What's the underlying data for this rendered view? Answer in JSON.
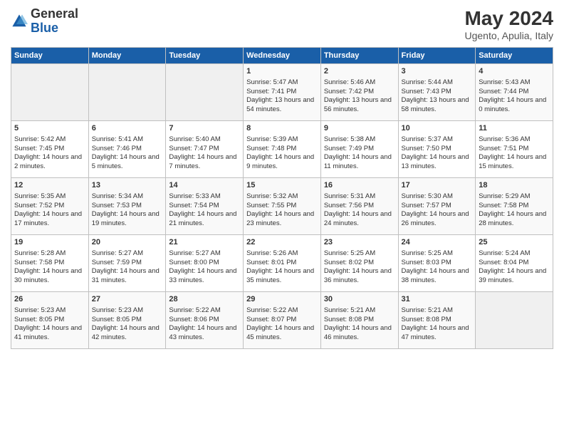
{
  "header": {
    "logo_general": "General",
    "logo_blue": "Blue",
    "month_year": "May 2024",
    "location": "Ugento, Apulia, Italy"
  },
  "days_of_week": [
    "Sunday",
    "Monday",
    "Tuesday",
    "Wednesday",
    "Thursday",
    "Friday",
    "Saturday"
  ],
  "weeks": [
    [
      {
        "day": "",
        "empty": true
      },
      {
        "day": "",
        "empty": true
      },
      {
        "day": "",
        "empty": true
      },
      {
        "day": "1",
        "sunrise": "Sunrise: 5:47 AM",
        "sunset": "Sunset: 7:41 PM",
        "daylight": "Daylight: 13 hours and 54 minutes."
      },
      {
        "day": "2",
        "sunrise": "Sunrise: 5:46 AM",
        "sunset": "Sunset: 7:42 PM",
        "daylight": "Daylight: 13 hours and 56 minutes."
      },
      {
        "day": "3",
        "sunrise": "Sunrise: 5:44 AM",
        "sunset": "Sunset: 7:43 PM",
        "daylight": "Daylight: 13 hours and 58 minutes."
      },
      {
        "day": "4",
        "sunrise": "Sunrise: 5:43 AM",
        "sunset": "Sunset: 7:44 PM",
        "daylight": "Daylight: 14 hours and 0 minutes."
      }
    ],
    [
      {
        "day": "5",
        "sunrise": "Sunrise: 5:42 AM",
        "sunset": "Sunset: 7:45 PM",
        "daylight": "Daylight: 14 hours and 2 minutes."
      },
      {
        "day": "6",
        "sunrise": "Sunrise: 5:41 AM",
        "sunset": "Sunset: 7:46 PM",
        "daylight": "Daylight: 14 hours and 5 minutes."
      },
      {
        "day": "7",
        "sunrise": "Sunrise: 5:40 AM",
        "sunset": "Sunset: 7:47 PM",
        "daylight": "Daylight: 14 hours and 7 minutes."
      },
      {
        "day": "8",
        "sunrise": "Sunrise: 5:39 AM",
        "sunset": "Sunset: 7:48 PM",
        "daylight": "Daylight: 14 hours and 9 minutes."
      },
      {
        "day": "9",
        "sunrise": "Sunrise: 5:38 AM",
        "sunset": "Sunset: 7:49 PM",
        "daylight": "Daylight: 14 hours and 11 minutes."
      },
      {
        "day": "10",
        "sunrise": "Sunrise: 5:37 AM",
        "sunset": "Sunset: 7:50 PM",
        "daylight": "Daylight: 14 hours and 13 minutes."
      },
      {
        "day": "11",
        "sunrise": "Sunrise: 5:36 AM",
        "sunset": "Sunset: 7:51 PM",
        "daylight": "Daylight: 14 hours and 15 minutes."
      }
    ],
    [
      {
        "day": "12",
        "sunrise": "Sunrise: 5:35 AM",
        "sunset": "Sunset: 7:52 PM",
        "daylight": "Daylight: 14 hours and 17 minutes."
      },
      {
        "day": "13",
        "sunrise": "Sunrise: 5:34 AM",
        "sunset": "Sunset: 7:53 PM",
        "daylight": "Daylight: 14 hours and 19 minutes."
      },
      {
        "day": "14",
        "sunrise": "Sunrise: 5:33 AM",
        "sunset": "Sunset: 7:54 PM",
        "daylight": "Daylight: 14 hours and 21 minutes."
      },
      {
        "day": "15",
        "sunrise": "Sunrise: 5:32 AM",
        "sunset": "Sunset: 7:55 PM",
        "daylight": "Daylight: 14 hours and 23 minutes."
      },
      {
        "day": "16",
        "sunrise": "Sunrise: 5:31 AM",
        "sunset": "Sunset: 7:56 PM",
        "daylight": "Daylight: 14 hours and 24 minutes."
      },
      {
        "day": "17",
        "sunrise": "Sunrise: 5:30 AM",
        "sunset": "Sunset: 7:57 PM",
        "daylight": "Daylight: 14 hours and 26 minutes."
      },
      {
        "day": "18",
        "sunrise": "Sunrise: 5:29 AM",
        "sunset": "Sunset: 7:58 PM",
        "daylight": "Daylight: 14 hours and 28 minutes."
      }
    ],
    [
      {
        "day": "19",
        "sunrise": "Sunrise: 5:28 AM",
        "sunset": "Sunset: 7:58 PM",
        "daylight": "Daylight: 14 hours and 30 minutes."
      },
      {
        "day": "20",
        "sunrise": "Sunrise: 5:27 AM",
        "sunset": "Sunset: 7:59 PM",
        "daylight": "Daylight: 14 hours and 31 minutes."
      },
      {
        "day": "21",
        "sunrise": "Sunrise: 5:27 AM",
        "sunset": "Sunset: 8:00 PM",
        "daylight": "Daylight: 14 hours and 33 minutes."
      },
      {
        "day": "22",
        "sunrise": "Sunrise: 5:26 AM",
        "sunset": "Sunset: 8:01 PM",
        "daylight": "Daylight: 14 hours and 35 minutes."
      },
      {
        "day": "23",
        "sunrise": "Sunrise: 5:25 AM",
        "sunset": "Sunset: 8:02 PM",
        "daylight": "Daylight: 14 hours and 36 minutes."
      },
      {
        "day": "24",
        "sunrise": "Sunrise: 5:25 AM",
        "sunset": "Sunset: 8:03 PM",
        "daylight": "Daylight: 14 hours and 38 minutes."
      },
      {
        "day": "25",
        "sunrise": "Sunrise: 5:24 AM",
        "sunset": "Sunset: 8:04 PM",
        "daylight": "Daylight: 14 hours and 39 minutes."
      }
    ],
    [
      {
        "day": "26",
        "sunrise": "Sunrise: 5:23 AM",
        "sunset": "Sunset: 8:05 PM",
        "daylight": "Daylight: 14 hours and 41 minutes."
      },
      {
        "day": "27",
        "sunrise": "Sunrise: 5:23 AM",
        "sunset": "Sunset: 8:05 PM",
        "daylight": "Daylight: 14 hours and 42 minutes."
      },
      {
        "day": "28",
        "sunrise": "Sunrise: 5:22 AM",
        "sunset": "Sunset: 8:06 PM",
        "daylight": "Daylight: 14 hours and 43 minutes."
      },
      {
        "day": "29",
        "sunrise": "Sunrise: 5:22 AM",
        "sunset": "Sunset: 8:07 PM",
        "daylight": "Daylight: 14 hours and 45 minutes."
      },
      {
        "day": "30",
        "sunrise": "Sunrise: 5:21 AM",
        "sunset": "Sunset: 8:08 PM",
        "daylight": "Daylight: 14 hours and 46 minutes."
      },
      {
        "day": "31",
        "sunrise": "Sunrise: 5:21 AM",
        "sunset": "Sunset: 8:08 PM",
        "daylight": "Daylight: 14 hours and 47 minutes."
      },
      {
        "day": "",
        "empty": true
      }
    ]
  ]
}
